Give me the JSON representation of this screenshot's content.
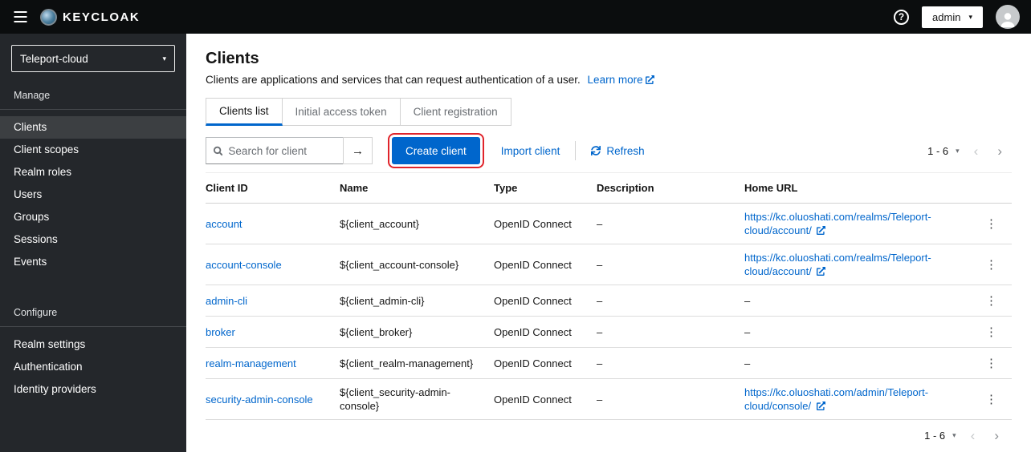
{
  "colors": {
    "accent": "#0066cc",
    "header_bg": "#0b0d0e",
    "sidebar_bg": "#24272b",
    "sidebar_active_bg": "#3c3f42",
    "annotation_red": "#e0242b",
    "link_blue": "#0066cc"
  },
  "header": {
    "brand": "KEYCLOAK",
    "help_icon": "?",
    "user": "admin"
  },
  "sidebar": {
    "realm": "Teleport-cloud",
    "sections": [
      {
        "label": "Manage",
        "items": [
          {
            "label": "Clients",
            "active": true
          },
          {
            "label": "Client scopes",
            "active": false
          },
          {
            "label": "Realm roles",
            "active": false
          },
          {
            "label": "Users",
            "active": false
          },
          {
            "label": "Groups",
            "active": false
          },
          {
            "label": "Sessions",
            "active": false
          },
          {
            "label": "Events",
            "active": false
          }
        ]
      },
      {
        "label": "Configure",
        "items": [
          {
            "label": "Realm settings",
            "active": false
          },
          {
            "label": "Authentication",
            "active": false
          },
          {
            "label": "Identity providers",
            "active": false
          }
        ]
      }
    ]
  },
  "main": {
    "title": "Clients",
    "description": "Clients are applications and services that can request authentication of a user.",
    "learn_more": "Learn more",
    "tabs": [
      {
        "label": "Clients list",
        "active": true
      },
      {
        "label": "Initial access token",
        "active": false
      },
      {
        "label": "Client registration",
        "active": false
      }
    ],
    "toolbar": {
      "search_placeholder": "Search for client",
      "search_submit": "→",
      "create_button": "Create client",
      "import_link": "Import client",
      "refresh_label": "Refresh",
      "pagination_label": "1 - 6"
    },
    "table": {
      "headers": [
        "Client ID",
        "Name",
        "Type",
        "Description",
        "Home URL"
      ],
      "rows": [
        {
          "client_id": "account",
          "name": "${client_account}",
          "type": "OpenID Connect",
          "description": "–",
          "home_url": "https://kc.oluoshati.com/realms/Teleport-cloud/account/"
        },
        {
          "client_id": "account-console",
          "name": "${client_account-console}",
          "type": "OpenID Connect",
          "description": "–",
          "home_url": "https://kc.oluoshati.com/realms/Teleport-cloud/account/"
        },
        {
          "client_id": "admin-cli",
          "name": "${client_admin-cli}",
          "type": "OpenID Connect",
          "description": "–",
          "home_url": "–"
        },
        {
          "client_id": "broker",
          "name": "${client_broker}",
          "type": "OpenID Connect",
          "description": "–",
          "home_url": "–"
        },
        {
          "client_id": "realm-management",
          "name": "${client_realm-management}",
          "type": "OpenID Connect",
          "description": "–",
          "home_url": "–"
        },
        {
          "client_id": "security-admin-console",
          "name": "${client_security-admin-console}",
          "type": "OpenID Connect",
          "description": "–",
          "home_url": "https://kc.oluoshati.com/admin/Teleport-cloud/console/"
        }
      ]
    },
    "pagination_bottom_label": "1 - 6"
  }
}
